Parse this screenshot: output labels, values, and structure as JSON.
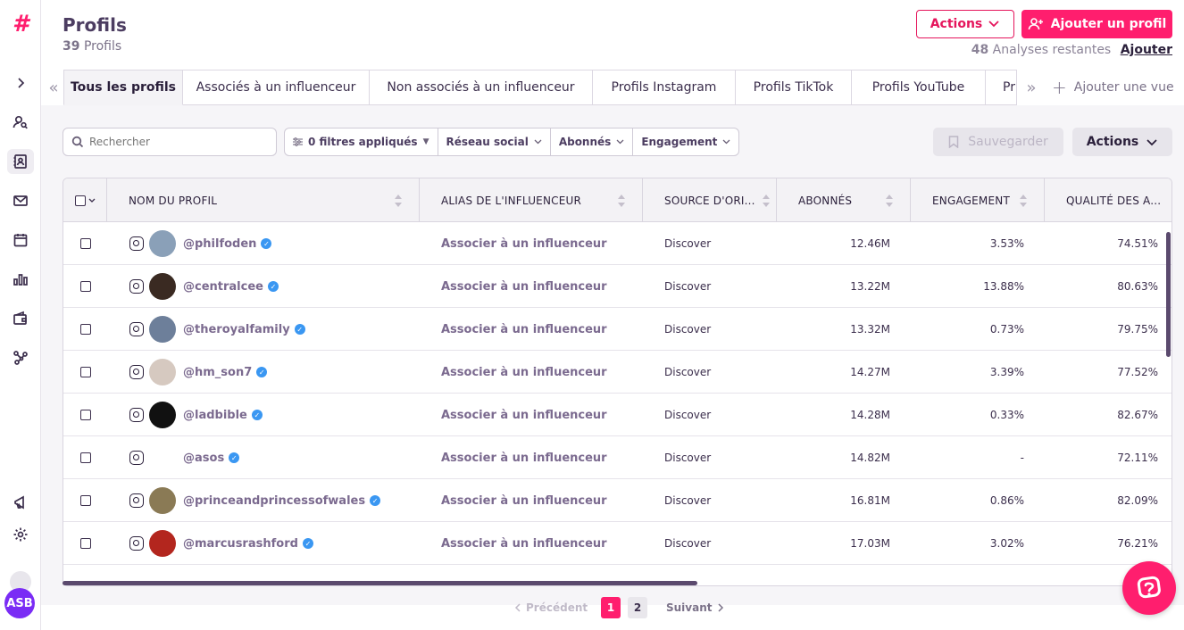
{
  "sidebar": {
    "logo": "#",
    "avatar_initials": "ASB"
  },
  "header": {
    "title": "Profils",
    "count": "39",
    "count_label": "Profils",
    "actions_label": "Actions",
    "add_profile_label": "Ajouter un profil",
    "analyses_count": "48",
    "analyses_label": "Analyses restantes",
    "analyses_add": "Ajouter"
  },
  "tabs": [
    {
      "label": "Tous les profils"
    },
    {
      "label": "Associés à un influenceur"
    },
    {
      "label": "Non associés à un influenceur"
    },
    {
      "label": "Profils Instagram"
    },
    {
      "label": "Profils TikTok"
    },
    {
      "label": "Profils YouTube"
    },
    {
      "label": "Pr"
    }
  ],
  "add_view_label": "Ajouter une vue",
  "toolbar": {
    "search_placeholder": "Rechercher",
    "filters_applied": "0 filtres appliqués",
    "filter_network": "Réseau social",
    "filter_followers": "Abonnés",
    "filter_engagement": "Engagement",
    "save_label": "Sauvegarder",
    "actions_label": "Actions"
  },
  "table": {
    "columns": [
      "NOM DU PROFIL",
      "ALIAS DE L'INFLUENCEUR",
      "SOURCE D'ORI...",
      "ABONNÉS",
      "ENGAGEMENT",
      "QUALITÉ DES A..."
    ],
    "rows": [
      {
        "handle": "@philfoden",
        "alias": "Associer à un influenceur",
        "source": "Discover",
        "followers": "12.46M",
        "engagement": "3.53%",
        "quality": "74.51%",
        "avatar_color": "#8aa0b8"
      },
      {
        "handle": "@centralcee",
        "alias": "Associer à un influenceur",
        "source": "Discover",
        "followers": "13.22M",
        "engagement": "13.88%",
        "quality": "80.63%",
        "avatar_color": "#3a2a22"
      },
      {
        "handle": "@theroyalfamily",
        "alias": "Associer à un influenceur",
        "source": "Discover",
        "followers": "13.32M",
        "engagement": "0.73%",
        "quality": "79.75%",
        "avatar_color": "#6d7f9a"
      },
      {
        "handle": "@hm_son7",
        "alias": "Associer à un influenceur",
        "source": "Discover",
        "followers": "14.27M",
        "engagement": "3.39%",
        "quality": "77.52%",
        "avatar_color": "#d6c9c0"
      },
      {
        "handle": "@ladbible",
        "alias": "Associer à un influenceur",
        "source": "Discover",
        "followers": "14.28M",
        "engagement": "0.33%",
        "quality": "82.67%",
        "avatar_color": "#111111"
      },
      {
        "handle": "@asos",
        "alias": "Associer à un influenceur",
        "source": "Discover",
        "followers": "14.82M",
        "engagement": "-",
        "quality": "72.11%",
        "avatar_color": "#ffffff"
      },
      {
        "handle": "@princeandprincessofwales",
        "alias": "Associer à un influenceur",
        "source": "Discover",
        "followers": "16.81M",
        "engagement": "0.86%",
        "quality": "82.09%",
        "avatar_color": "#8a7a55"
      },
      {
        "handle": "@marcusrashford",
        "alias": "Associer à un influenceur",
        "source": "Discover",
        "followers": "17.03M",
        "engagement": "3.02%",
        "quality": "76.21%",
        "avatar_color": "#b3261e"
      }
    ]
  },
  "pagination": {
    "prev": "Précédent",
    "page1": "1",
    "page2": "2",
    "next": "Suivant"
  },
  "colors": {
    "brand": "#ff1e6e",
    "verified": "#3a97f2"
  }
}
